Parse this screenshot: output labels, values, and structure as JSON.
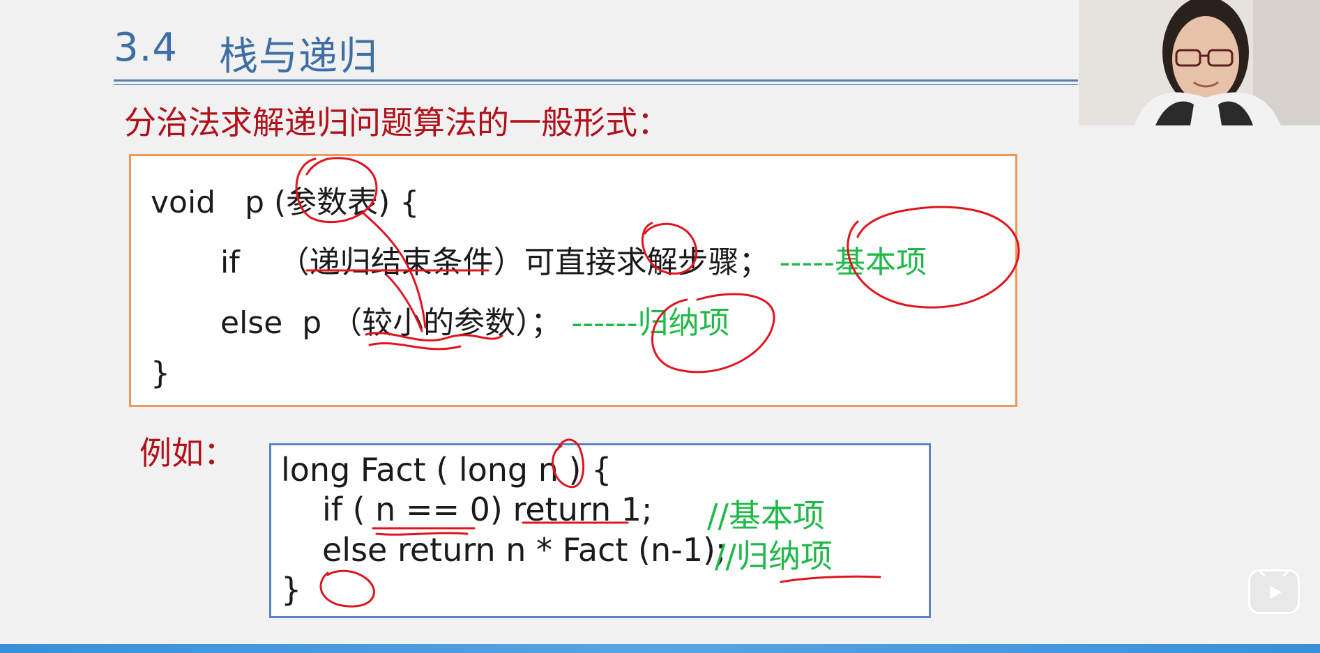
{
  "slide": {
    "section_number": "3.4",
    "section_title": "栈与递归",
    "subtitle": "分治法求解递归问题算法的一般形式：",
    "general_form": {
      "line1": "void   p (参数表) {",
      "line2_code": "if    （递归结束条件）可直接求解步骤；",
      "line2_comment": "-----基本项",
      "line3_code": "else  p （较小的参数）；",
      "line3_comment": "------归纳项",
      "line4": "}"
    },
    "example_label": "例如：",
    "example": {
      "line1": "long Fact ( long n ) {",
      "line2_code": "if ( n == 0) return 1;",
      "line2_comment": "//基本项",
      "line3_code": "else return n * Fact (n-1);",
      "line3_comment": "//归纳项",
      "line4": "}"
    }
  },
  "overlay": {
    "webcam": "presenter-webcam",
    "play_icon": "play-icon"
  },
  "colors": {
    "title_blue": "#3d6fa5",
    "heading_red": "#b0101a",
    "comment_green": "#21b84a",
    "box_orange": "#f0975a",
    "box_blue": "#5a84c2",
    "ink_red": "#e0141e"
  }
}
